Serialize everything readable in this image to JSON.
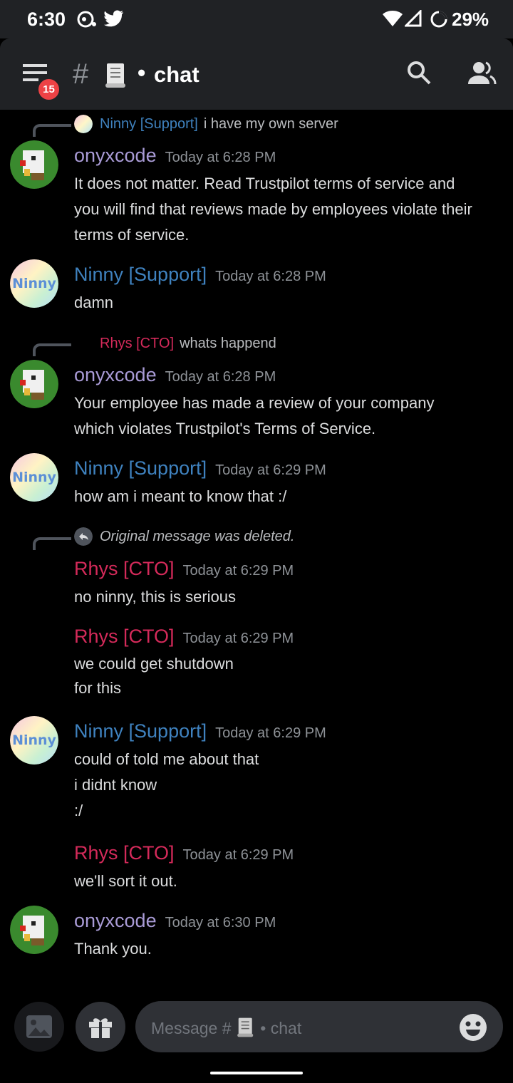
{
  "status_bar": {
    "time": "6:30",
    "battery": "29%"
  },
  "header": {
    "badge": "15",
    "hash": "#",
    "channel_name": "chat"
  },
  "messages": [
    {
      "reply": {
        "author": "Ninny [Support]",
        "text": "i have my own server"
      },
      "author": "onyxcode",
      "timestamp": "Today at 6:28 PM",
      "text": "It does not matter. Read Trustpilot terms of service and\nyou will find that reviews made by employees violate their\nterms of service."
    },
    {
      "author": "Ninny [Support]",
      "timestamp": "Today at 6:28 PM",
      "text": "damn"
    },
    {
      "reply": {
        "author": "Rhys [CTO]",
        "text": "whats happend"
      },
      "author": "onyxcode",
      "timestamp": "Today at 6:28 PM",
      "text": "Your employee has made a review of your company\nwhich violates Trustpilot's Terms of Service."
    },
    {
      "author": "Ninny [Support]",
      "timestamp": "Today at 6:29 PM",
      "text": "how am i meant to know that :/"
    },
    {
      "reply": {
        "text": "Original message was deleted."
      },
      "author": "Rhys [CTO]",
      "timestamp": "Today at 6:29 PM",
      "text": "no ninny, this is serious"
    },
    {
      "author": "Rhys [CTO]",
      "timestamp": "Today at 6:29 PM",
      "text": "we could get shutdown\nfor this"
    },
    {
      "author": "Ninny [Support]",
      "timestamp": "Today at 6:29 PM",
      "text": "could of told me about that\ni didnt know\n:/"
    },
    {
      "author": "Rhys [CTO]",
      "timestamp": "Today at 6:29 PM",
      "text": "we'll sort it out."
    },
    {
      "author": "onyxcode",
      "timestamp": "Today at 6:30 PM",
      "text": "Thank you."
    }
  ],
  "composer": {
    "placeholder_prefix": "Message #",
    "placeholder_channel": "chat"
  },
  "colors": {
    "onyxcode": "#a99bd6",
    "ninny": "#3f82bf",
    "rhys": "#d42a5a",
    "background": "#000000",
    "header": "#202225"
  }
}
